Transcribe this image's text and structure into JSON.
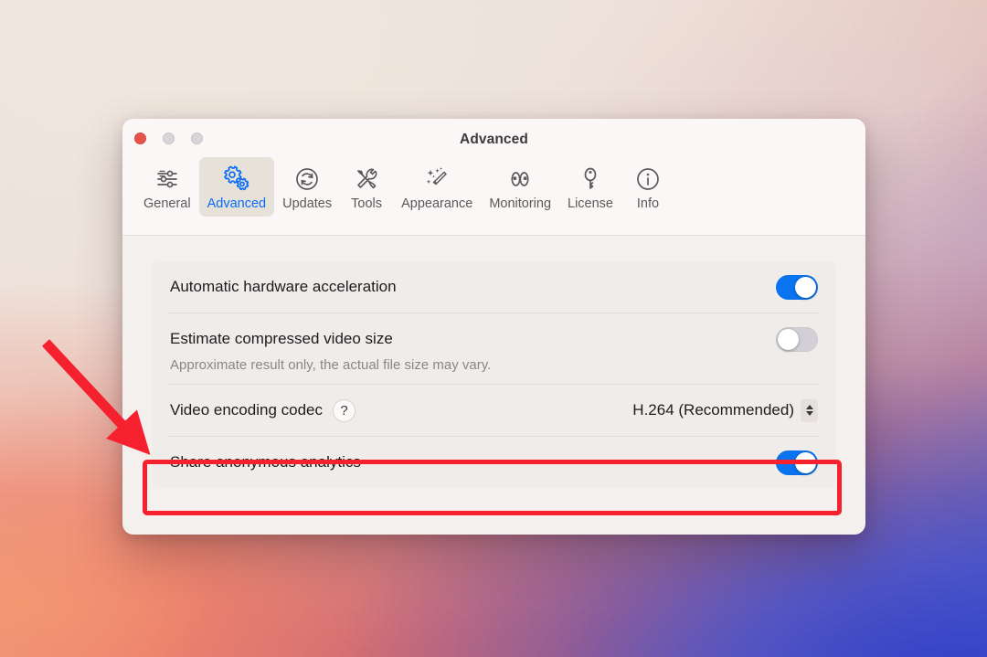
{
  "window": {
    "title": "Advanced",
    "traffic_lights": [
      {
        "name": "close",
        "label": "Close",
        "color": "#e8524a",
        "active": true
      },
      {
        "name": "minimize",
        "label": "Minimize",
        "color": "#d7d4da",
        "active": false
      },
      {
        "name": "zoom",
        "label": "Zoom",
        "color": "#d7d4da",
        "active": false
      }
    ]
  },
  "toolbar": {
    "selected": "Advanced",
    "accent_color": "#0a6cf5",
    "tabs": [
      {
        "label": "General",
        "icon": "sliders-icon",
        "selected": false
      },
      {
        "label": "Advanced",
        "icon": "gears-icon",
        "selected": true
      },
      {
        "label": "Updates",
        "icon": "refresh-icon",
        "selected": false
      },
      {
        "label": "Tools",
        "icon": "tools-icon",
        "selected": false
      },
      {
        "label": "Appearance",
        "icon": "magic-wand-icon",
        "selected": false
      },
      {
        "label": "Monitoring",
        "icon": "eyes-icon",
        "selected": false
      },
      {
        "label": "License",
        "icon": "key-icon",
        "selected": false
      },
      {
        "label": "Info",
        "icon": "info-icon",
        "selected": false
      }
    ]
  },
  "settings": {
    "rows": [
      {
        "label": "Automatic hardware acceleration",
        "control": "toggle",
        "value": "on",
        "subtitle": null
      },
      {
        "label": "Estimate compressed video size",
        "control": "toggle",
        "value": "off",
        "subtitle": "Approximate result only, the actual file size may vary."
      },
      {
        "label": "Video encoding codec",
        "control": "popup",
        "value": "H.264 (Recommended)",
        "help": "?",
        "subtitle": null
      },
      {
        "label": "Share anonymous analytics",
        "control": "toggle",
        "value": "on",
        "subtitle": null,
        "highlighted": true
      }
    ]
  },
  "annotations": {
    "highlight_color": "#f5212e",
    "arrow_color": "#f5212e",
    "highlight_target": "Share anonymous analytics",
    "arrow_points_to": "Share anonymous analytics"
  },
  "toggle_colors": {
    "on": "#0a74f0",
    "off": "#d3cfd6",
    "knob": "#ffffff"
  }
}
